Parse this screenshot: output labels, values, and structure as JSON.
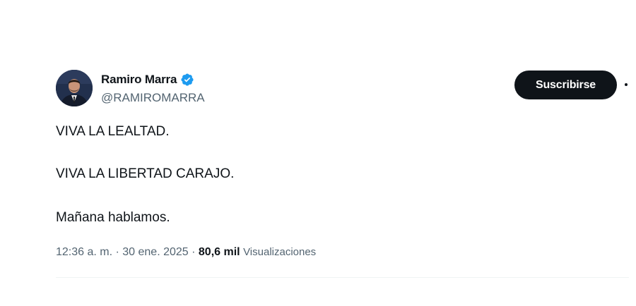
{
  "author": {
    "display_name": "Ramiro Marra",
    "handle": "@RAMIROMARRA",
    "avatar_icon": "profile-photo",
    "verified_icon": "verified-badge-icon",
    "verified_color": "#1d9bf0"
  },
  "actions": {
    "subscribe_label": "Suscribirse",
    "more_icon": "more-options-icon"
  },
  "tweet": {
    "lines": [
      "VIVA LA LEALTAD.",
      "VIVA LA LIBERTAD CARAJO.",
      "Mañana hablamos."
    ]
  },
  "meta": {
    "time": "12:36 a. m.",
    "separator": " · ",
    "date": "30 ene. 2025",
    "views_count": "80,6 mil",
    "views_label": "Visualizaciones"
  },
  "colors": {
    "text": "#0f1419",
    "secondary": "#536471",
    "button_bg": "#0f1419",
    "verified": "#1d9bf0"
  }
}
